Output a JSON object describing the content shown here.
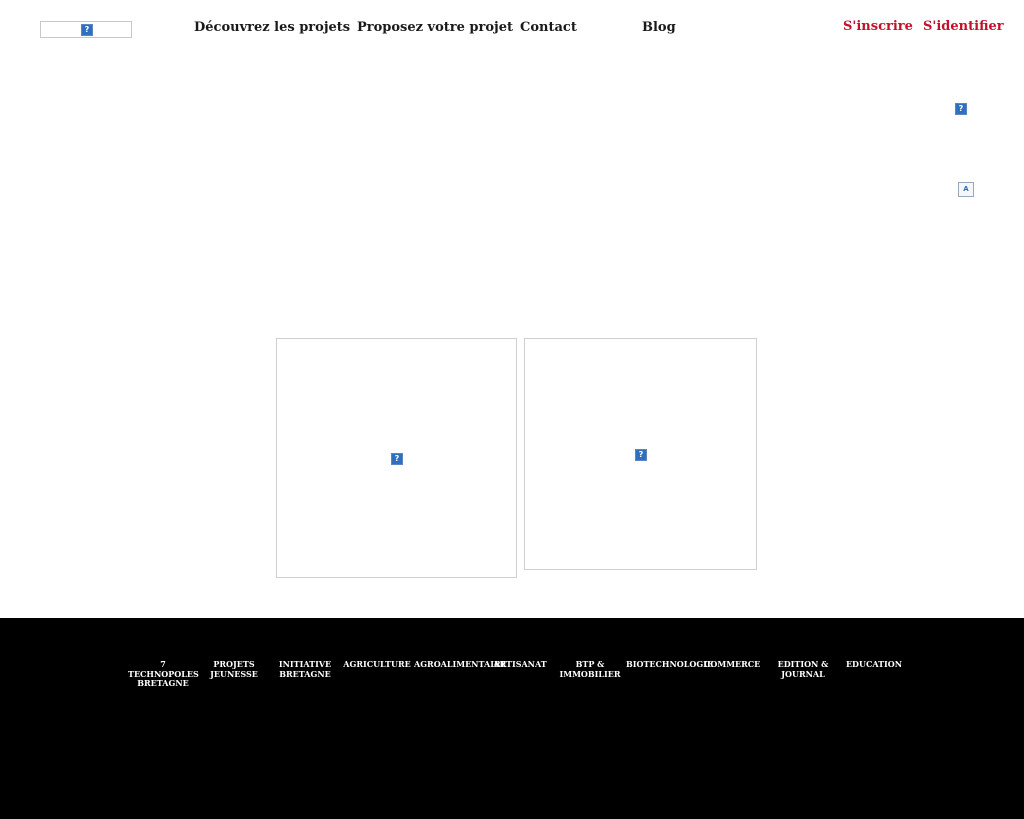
{
  "header": {
    "logo_icon": "broken-image-icon",
    "nav": [
      {
        "label": "Découvrez les projets"
      },
      {
        "label": "Proposez votre projet"
      },
      {
        "label": "Contact"
      },
      {
        "label": "Blog"
      }
    ],
    "auth": {
      "signup": "S'inscrire",
      "login": "S'identifier"
    }
  },
  "side_icons": [
    "broken-image-icon",
    "document-icon"
  ],
  "cards": [
    "broken-image-icon",
    "broken-image-icon"
  ],
  "footer": {
    "categories": [
      {
        "label": "7\nTECHNOPOLES\nBRETAGNE"
      },
      {
        "label": "PROJETS\nJEUNESSE"
      },
      {
        "label": "INITIATIVE\nBRETAGNE"
      },
      {
        "label": "AGRICULTURE"
      },
      {
        "label": "AGROALIMENTAIRE"
      },
      {
        "label": "ARTISANAT"
      },
      {
        "label": "BTP &\nIMMOBILIER"
      },
      {
        "label": "BIOTECHNOLOGIE"
      },
      {
        "label": "COMMERCE"
      },
      {
        "label": "EDITION &\nJOURNAL"
      },
      {
        "label": "EDUCATION"
      }
    ]
  },
  "colors": {
    "nav_text": "#1a1a1a",
    "auth_accent": "#c4102e",
    "footer_bg": "#000000",
    "footer_text": "#ffffff"
  },
  "broken_image_glyph": "?"
}
